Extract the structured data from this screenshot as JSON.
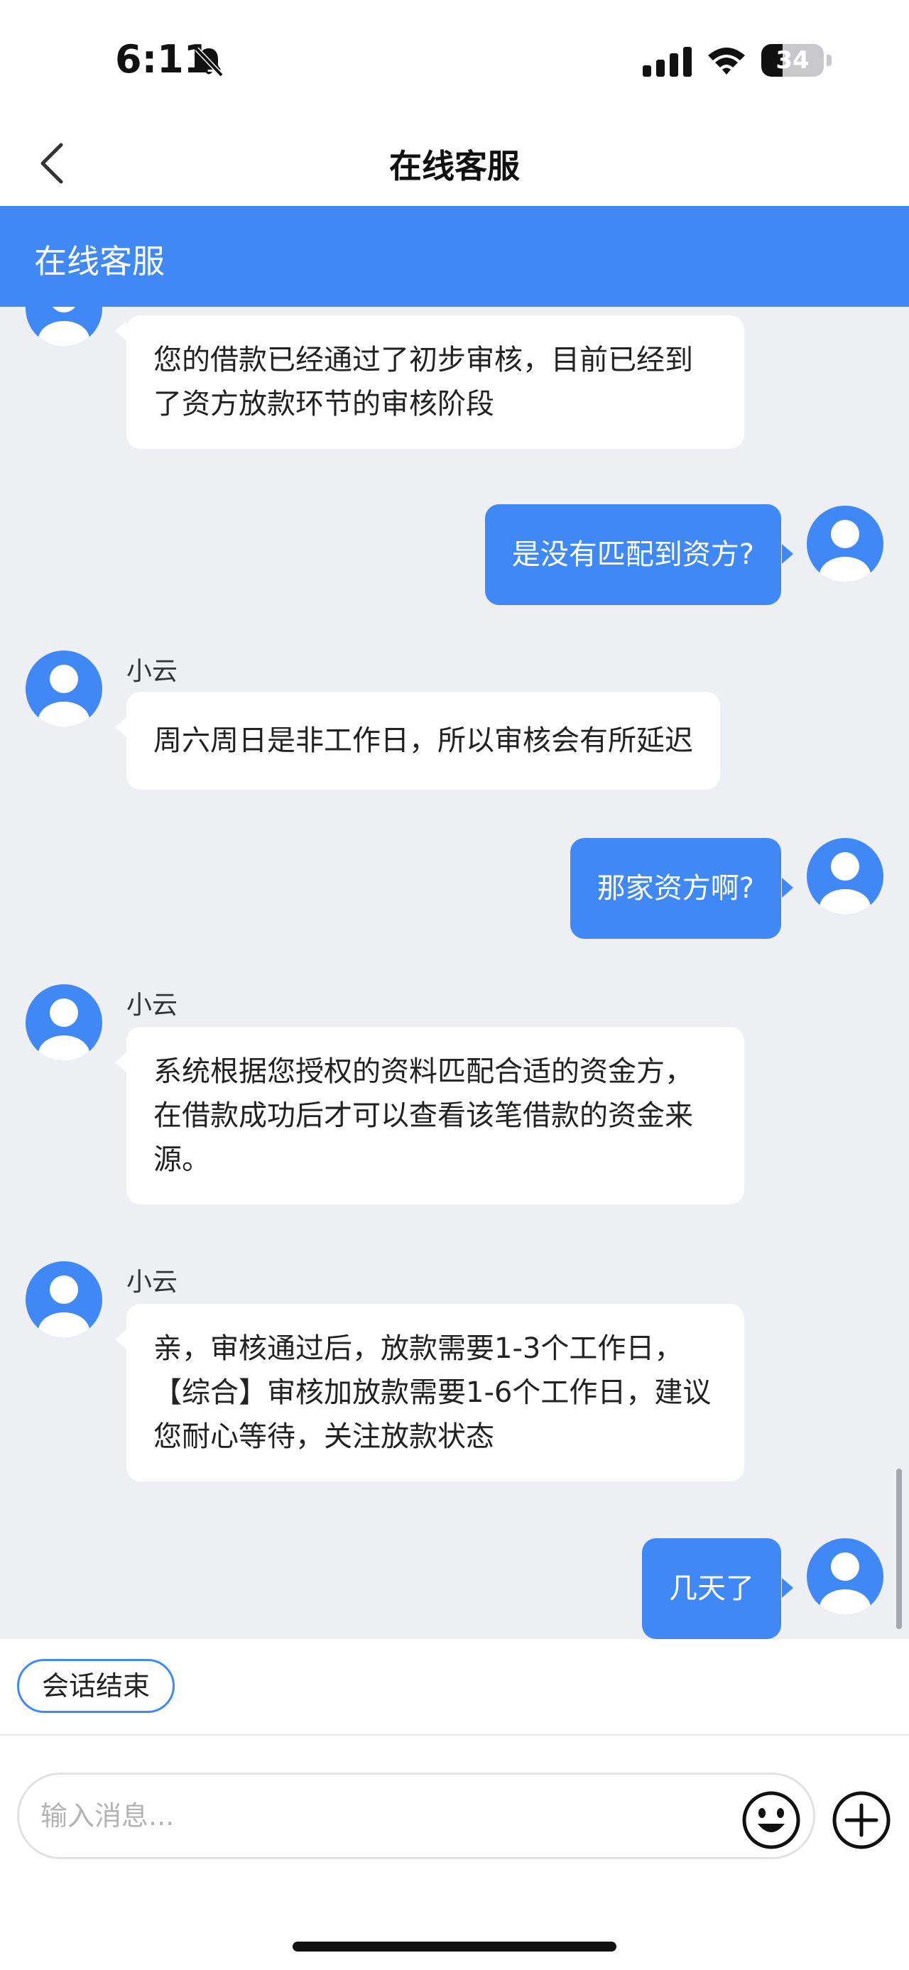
{
  "status_bar": {
    "time": "6:11",
    "battery": "34",
    "battery_level": 0.34
  },
  "nav": {
    "title": "在线客服"
  },
  "chat_header": {
    "title": "在线客服"
  },
  "messages": [
    {
      "side": "in",
      "sender": "",
      "text": "您的借款已经通过了初步审核，目前已经到了资方放款环节的审核阶段"
    },
    {
      "side": "out",
      "text": "是没有匹配到资方?"
    },
    {
      "side": "in",
      "sender": "小云",
      "text": "周六周日是非工作日，所以审核会有所延迟"
    },
    {
      "side": "out",
      "text": "那家资方啊?"
    },
    {
      "side": "in",
      "sender": "小云",
      "text": "系统根据您授权的资料匹配合适的资金方，在借款成功后才可以查看该笔借款的资金来源。"
    },
    {
      "side": "in",
      "sender": "小云",
      "text": "亲，审核通过后，放款需要1-3个工作日，【综合】审核加放款需要1-6个工作日，建议您耐心等待，关注放款状态"
    },
    {
      "side": "out",
      "text": "几天了"
    }
  ],
  "quick_reply": {
    "end_label": "会话结束"
  },
  "input": {
    "placeholder": "输入消息...",
    "value": ""
  },
  "colors": {
    "accent": "#3f88f5",
    "chat_bg": "#eeeff3"
  },
  "icons": [
    "back-chevron-icon",
    "bell-slash-icon",
    "signal-icon",
    "wifi-icon",
    "battery-icon",
    "user-avatar-icon",
    "emoji-icon",
    "plus-icon"
  ]
}
